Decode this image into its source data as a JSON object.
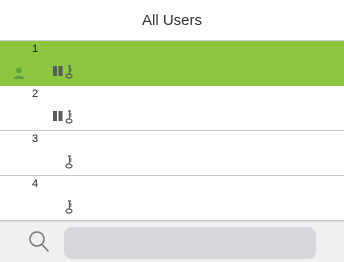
{
  "header": {
    "title": "All Users"
  },
  "users": [
    {
      "id": "1",
      "selected": true,
      "icons": [
        "user-icon",
        "card-icon",
        "password-key-icon"
      ]
    },
    {
      "id": "2",
      "selected": false,
      "icons": [
        "card-icon",
        "password-key-icon"
      ]
    },
    {
      "id": "3",
      "selected": false,
      "icons": [
        "password-key-icon"
      ]
    },
    {
      "id": "4",
      "selected": false,
      "icons": [
        "password-key-icon"
      ]
    }
  ],
  "search": {
    "icon": "search-icon",
    "placeholder": "",
    "value": ""
  },
  "colors": {
    "selected_row": "#8cc63f",
    "icon": "#5a5a5a",
    "user_icon_selected": "#5fa042",
    "search_field": "#d6d6dc"
  }
}
